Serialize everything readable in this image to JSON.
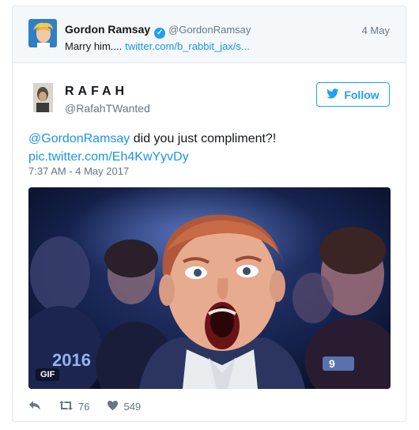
{
  "quoted": {
    "name": "Gordon Ramsay",
    "handle": "@GordonRamsay",
    "date": "4 May",
    "text": "Marry him....",
    "link": "twitter.com/b_rabbit_jax/s..."
  },
  "tweet": {
    "name": "RAFAH",
    "handle": "@RafahTWanted",
    "follow_label": "Follow",
    "mention": "@GordonRamsay",
    "text": " did you just compliment?!",
    "pic_link": "pic.twitter.com/Eh4KwYyvDy",
    "timestamp": "7:37 AM - 4 May 2017"
  },
  "media": {
    "gif_label": "GIF",
    "overlay_year": "2016",
    "channel": "9"
  },
  "actions": {
    "retweets": "76",
    "likes": "549"
  },
  "colors": {
    "accent": "#1da1f2",
    "link": "#1b95e0",
    "muted": "#657786"
  }
}
